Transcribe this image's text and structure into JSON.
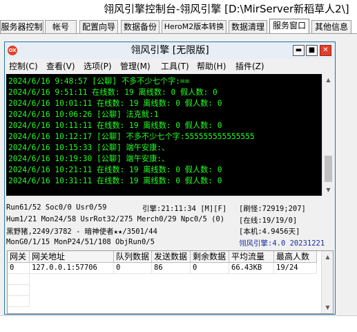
{
  "window": {
    "title": "翎风引擎控制台-翎风引擎 [D:\\MirServer新稻草人2\\]"
  },
  "tabs": [
    {
      "label": "服务器控制"
    },
    {
      "label": "帐号"
    },
    {
      "label": "配置向导"
    },
    {
      "label": "数据备份"
    },
    {
      "label": "HeroM2版本转换"
    },
    {
      "label": "数据清理"
    },
    {
      "label": "服务窗口",
      "active": true
    },
    {
      "label": "其他信息"
    }
  ],
  "engine_window": {
    "title": "翎风引擎 [无限版]",
    "icon_text": "OX",
    "minimize": "▬",
    "maximize": "■",
    "close": "✕"
  },
  "menu": [
    {
      "label": "控制(C)"
    },
    {
      "label": "查看(V)"
    },
    {
      "label": "选项(P)"
    },
    {
      "label": "管理(M)"
    },
    {
      "label": "工具(T)"
    },
    {
      "label": "帮助(H)"
    },
    {
      "label": "插件(Z)"
    }
  ],
  "log_lines": [
    "2024/6/16 9:48:57 [公聊] 不多不少七个字:==",
    "2024/6/16 9:51:11 在线数: 19 离线数: 0 假人数: 0",
    "2024/6/16 10:01:11 在线数: 19 离线数: 0 假人数: 0",
    "2024/6/16 10:06:26 [公聊] 法克鱿:1",
    "2024/6/16 10:11:11 在线数: 19 离线数: 0 假人数: 0",
    "2024/6/16 10:12:17 [公聊] 不多不少七个字:555555555555555",
    "2024/6/16 10:15:33 [公聊] 端午安康:、",
    "2024/6/16 10:19:30 [公聊] 端午安康:、",
    "2024/6/16 10:21:11 在线数: 19 离线数: 0 假人数: 0",
    "2024/6/16 10:31:11 在线数: 19 离线数: 0 假人数: 0"
  ],
  "status": {
    "run": "Run61/52 Soc0/0 Usr0/59",
    "engine_time": "引擎:21:11:34 [M][F]",
    "refresh": "[刷怪:72919;207]",
    "hum": "Hum1/21 Mon24/58 UsrRot32/275 Merch0/29 Npc0/5 (0)",
    "online": "[在线:19/19/0]",
    "player": "黑野猪,2249/3782 - 暗神使者★★/3501/44",
    "uptime": "[本机:4.9456天]",
    "mon": "MonG0/1/15 MonP24/51/108 ObjRun0/5",
    "version": "翎风引擎:4.0 20231221"
  },
  "grid": {
    "columns": [
      "网关",
      "网关地址",
      "队列数据",
      "发送数据",
      "剩余数据",
      "平均流量",
      "最高人数"
    ],
    "rows": [
      [
        "0",
        "127.0.0.1:57706",
        "0",
        "86",
        "0",
        "66.43KB",
        "19/24"
      ]
    ]
  }
}
